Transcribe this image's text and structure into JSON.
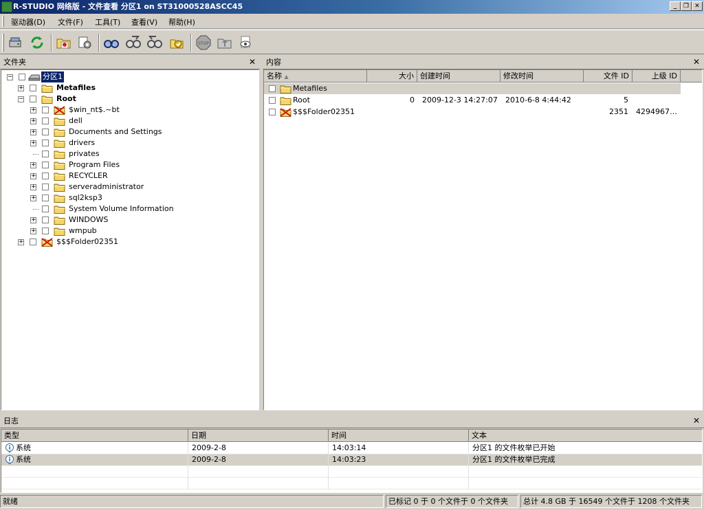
{
  "window": {
    "title": "R-STUDIO 网络版 - 文件查看 分区1 on ST31000528ASCC45",
    "controls": [
      "minimize",
      "restore",
      "close"
    ]
  },
  "menu": [
    "驱动器(D)",
    "文件(F)",
    "工具(T)",
    "查看(V)",
    "帮助(H)"
  ],
  "toolbar": {
    "buttons": [
      "open-drive-icon",
      "refresh-icon",
      "new-folder-icon",
      "properties-icon",
      "find-icon",
      "find-next-icon",
      "find-previous-icon",
      "mark-icon",
      "stop-icon",
      "up-folder-icon",
      "preview-icon"
    ]
  },
  "folders_pane": {
    "title": "文件夹",
    "close": "✕",
    "root": "分区1",
    "items": [
      {
        "label": "Metafiles",
        "level": 1,
        "bold": true,
        "expander": "+",
        "deleted": false
      },
      {
        "label": "Root",
        "level": 1,
        "bold": true,
        "expander": "−",
        "deleted": false
      },
      {
        "label": "$win_nt$.~bt",
        "level": 2,
        "bold": false,
        "expander": "+",
        "deleted": true
      },
      {
        "label": "dell",
        "level": 2,
        "bold": false,
        "expander": "+",
        "deleted": false
      },
      {
        "label": "Documents and Settings",
        "level": 2,
        "bold": false,
        "expander": "+",
        "deleted": false
      },
      {
        "label": "drivers",
        "level": 2,
        "bold": false,
        "expander": "+",
        "deleted": false
      },
      {
        "label": "privates",
        "level": 2,
        "bold": false,
        "expander": "",
        "deleted": false
      },
      {
        "label": "Program Files",
        "level": 2,
        "bold": false,
        "expander": "+",
        "deleted": false
      },
      {
        "label": "RECYCLER",
        "level": 2,
        "bold": false,
        "expander": "+",
        "deleted": false
      },
      {
        "label": "serveradministrator",
        "level": 2,
        "bold": false,
        "expander": "+",
        "deleted": false
      },
      {
        "label": "sql2ksp3",
        "level": 2,
        "bold": false,
        "expander": "+",
        "deleted": false
      },
      {
        "label": "System Volume Information",
        "level": 2,
        "bold": false,
        "expander": "",
        "deleted": false
      },
      {
        "label": "WINDOWS",
        "level": 2,
        "bold": false,
        "expander": "+",
        "deleted": false
      },
      {
        "label": "wmpub",
        "level": 2,
        "bold": false,
        "expander": "+",
        "deleted": false
      },
      {
        "label": "$$$Folder02351",
        "level": 1,
        "bold": false,
        "expander": "+",
        "deleted": true
      }
    ]
  },
  "contents_pane": {
    "title": "内容",
    "close": "✕",
    "columns": [
      "名称",
      "大小",
      "创建时间",
      "修改时间",
      "文件 ID",
      "上级 ID"
    ],
    "rows": [
      {
        "name": "Metafiles",
        "size": "",
        "created": "",
        "modified": "",
        "file_id": "",
        "parent_id": "",
        "deleted": false,
        "selected": true
      },
      {
        "name": "Root",
        "size": "0",
        "created": "2009-12-3 14:27:07",
        "modified": "2010-6-8 4:44:42",
        "file_id": "5",
        "parent_id": "",
        "deleted": false,
        "selected": false
      },
      {
        "name": "$$$Folder02351",
        "size": "",
        "created": "",
        "modified": "",
        "file_id": "2351",
        "parent_id": "4294967…",
        "deleted": true,
        "selected": false
      }
    ]
  },
  "log_pane": {
    "title": "日志",
    "close": "✕",
    "columns": [
      "类型",
      "日期",
      "时间",
      "文本"
    ],
    "rows": [
      {
        "type": "系统",
        "date": "2009-2-8",
        "time": "14:03:14",
        "text": "分区1 的文件枚举已开始"
      },
      {
        "type": "系统",
        "date": "2009-2-8",
        "time": "14:03:23",
        "text": "分区1 的文件枚举已完成"
      }
    ]
  },
  "status": {
    "ready": "就绪",
    "marked": "已标记 0 于 0 个文件于 0 个文件夹",
    "total": "总计 4.8 GB 于 16549 个文件于 1208 个文件夹"
  },
  "colors": {
    "title_gradient_start": "#0a246a",
    "title_gradient_end": "#a6caf0",
    "window_bg": "#d4d0c8",
    "selection_bg": "#0a246a",
    "row_highlight": "#d4d0c8",
    "folder_yellow": "#f5d66a"
  }
}
